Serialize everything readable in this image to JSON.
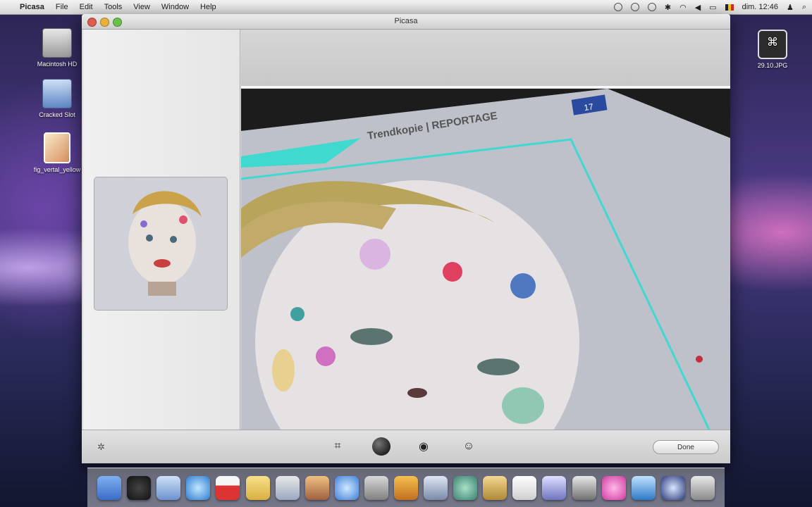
{
  "menubar": {
    "app_name": "Picasa",
    "menus": [
      "File",
      "Edit",
      "Tools",
      "View",
      "Window",
      "Help"
    ],
    "clock": "dim. 12:46"
  },
  "desktop": {
    "icons": [
      {
        "label": "Macintosh HD",
        "kind": "hard-drive"
      },
      {
        "label": "Cracked Slot",
        "kind": "disk-image"
      },
      {
        "label": "fig_vertal_yellow",
        "kind": "image-file"
      }
    ],
    "right_icon": {
      "label": "29.10.JPG",
      "kind": "file"
    }
  },
  "window": {
    "title": "Picasa",
    "photo_text": {
      "header": "Trendkopie | REPORTAGE",
      "page_number": "17"
    },
    "done_label": "Done"
  },
  "dock": {
    "items": [
      "finder",
      "dashboard",
      "mail",
      "safari",
      "ical",
      "notes",
      "preview",
      "iphoto",
      "itunes",
      "network",
      "garageband",
      "spaces",
      "time-machine",
      "address",
      "textedit",
      "script",
      "calculator",
      "pink-app",
      "photo-app",
      "terminal",
      "cd",
      "trash"
    ]
  },
  "colors": {
    "highlight_cyan": "#3fd9d0",
    "window_bg": "#d9d9d9"
  }
}
